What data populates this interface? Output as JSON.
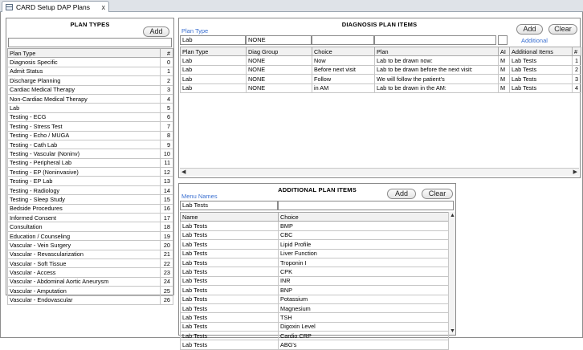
{
  "tab": {
    "title": "CARD Setup DAP Plans",
    "icon": "grid-icon",
    "close": "x"
  },
  "plan_types": {
    "title": "PLAN TYPES",
    "add_label": "Add",
    "search_value": "",
    "columns": [
      "Plan Type",
      "#"
    ],
    "rows": [
      [
        "Diagnosis Specific",
        "0"
      ],
      [
        "Admit Status",
        "1"
      ],
      [
        "Discharge Planning",
        "2"
      ],
      [
        "Cardiac Medical Therapy",
        "3"
      ],
      [
        "Non-Cardiac Medical Therapy",
        "4"
      ],
      [
        "Lab",
        "5"
      ],
      [
        "Testing - ECG",
        "6"
      ],
      [
        "Testing - Stress Test",
        "7"
      ],
      [
        "Testing - Echo / MUGA",
        "8"
      ],
      [
        "Testing - Cath Lab",
        "9"
      ],
      [
        "Testing - Vascular (Noninv)",
        "10"
      ],
      [
        "Testing - Peripheral Lab",
        "11"
      ],
      [
        "Testing - EP (Noninvasive)",
        "12"
      ],
      [
        "Testing - EP Lab",
        "13"
      ],
      [
        "Testing - Radiology",
        "14"
      ],
      [
        "Testing - Sleep Study",
        "15"
      ],
      [
        "Bedside Procedures",
        "16"
      ],
      [
        "Informed Consent",
        "17"
      ],
      [
        "Consultation",
        "18"
      ],
      [
        "Education / Counseling",
        "19"
      ],
      [
        "Vascular - Vein Surgery",
        "20"
      ],
      [
        "Vascular - Revascularization",
        "21"
      ],
      [
        "Vascular - Soft Tissue",
        "22"
      ],
      [
        "Vascular - Access",
        "23"
      ],
      [
        "Vascular - Abdominal Aortic Aneurysm",
        "24"
      ],
      [
        "Vascular - Amputation",
        "25"
      ],
      [
        "Vascular - Endovascular",
        "26"
      ]
    ]
  },
  "diagnosis": {
    "title": "DIAGNOSIS PLAN ITEMS",
    "plan_type_label": "Plan Type",
    "add_label": "Add",
    "clear_label": "Clear",
    "additional_link": "Additional",
    "filters": [
      "Lab",
      "NONE",
      "",
      ""
    ],
    "columns": [
      "Plan Type",
      "Diag Group",
      "Choice",
      "Plan",
      "AI",
      "Additional Items",
      "#"
    ],
    "rows": [
      [
        "Lab",
        "NONE",
        "Now",
        "Lab to be drawn now:",
        "M",
        "Lab Tests",
        "1"
      ],
      [
        "Lab",
        "NONE",
        "Before next visit",
        "Lab to be drawn before the next visit:",
        "M",
        "Lab Tests",
        "2"
      ],
      [
        "Lab",
        "NONE",
        "Follow",
        "We will follow the patient's",
        "M",
        "Lab Tests",
        "3"
      ],
      [
        "Lab",
        "NONE",
        "in AM",
        "Lab to be drawn in the AM:",
        "M",
        "Lab Tests",
        "4"
      ]
    ]
  },
  "additional": {
    "title": "ADDITIONAL PLAN ITEMS",
    "menu_names_label": "Menu Names",
    "add_label": "Add",
    "clear_label": "Clear",
    "filter_name": "Lab Tests",
    "filter_choice": "",
    "columns": [
      "Name",
      "Choice"
    ],
    "rows": [
      [
        "Lab Tests",
        "BMP"
      ],
      [
        "Lab Tests",
        "CBC"
      ],
      [
        "Lab Tests",
        "Lipid Profile"
      ],
      [
        "Lab Tests",
        "Liver Function"
      ],
      [
        "Lab Tests",
        "Troponin I"
      ],
      [
        "Lab Tests",
        "CPK"
      ],
      [
        "Lab Tests",
        "INR"
      ],
      [
        "Lab Tests",
        "BNP"
      ],
      [
        "Lab Tests",
        "Potassium"
      ],
      [
        "Lab Tests",
        "Magnesium"
      ],
      [
        "Lab Tests",
        "TSH"
      ],
      [
        "Lab Tests",
        "Digoxin Level"
      ],
      [
        "Lab Tests",
        "Cardio CRP"
      ],
      [
        "Lab Tests",
        "ABG's"
      ]
    ]
  }
}
